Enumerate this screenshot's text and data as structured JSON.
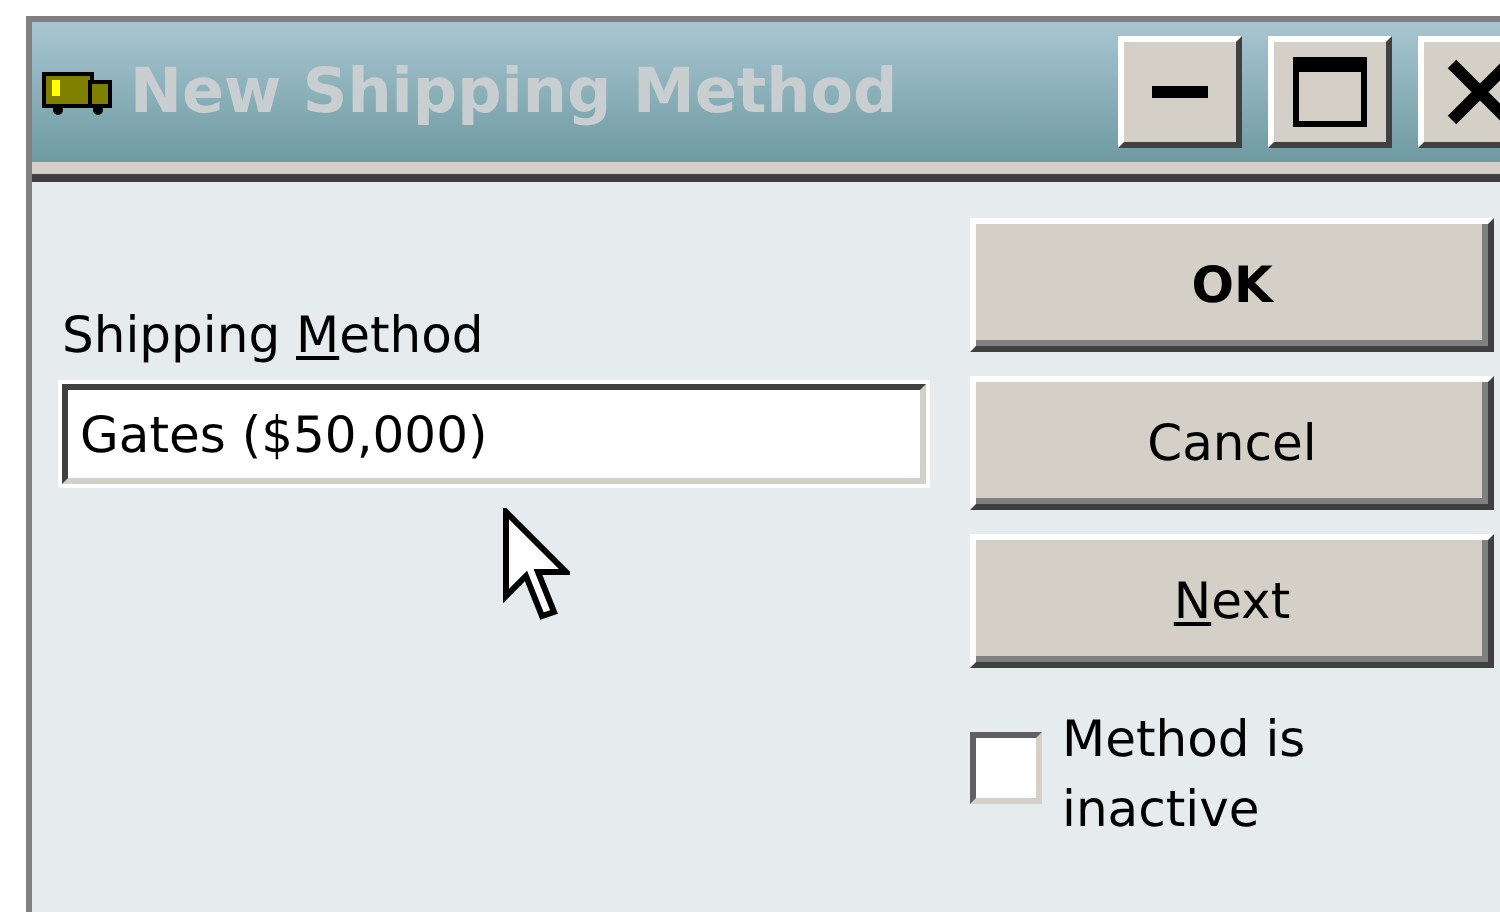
{
  "window": {
    "title": "New Shipping Method",
    "active": false
  },
  "field": {
    "label": [
      {
        "text": "Shipping "
      },
      {
        "text": "M",
        "underlined": true
      },
      {
        "text": "ethod"
      }
    ],
    "value": "Gates ($50,000)"
  },
  "buttons": [
    {
      "label": [
        {
          "text": "OK"
        }
      ],
      "default": true
    },
    {
      "label": [
        {
          "text": "Cancel"
        }
      ],
      "default": false
    },
    {
      "label": [
        {
          "text": "N",
          "underlined": true
        },
        {
          "text": "ext"
        }
      ],
      "default": false
    }
  ],
  "checkbox": {
    "label": "Method is inactive",
    "checked": false
  }
}
